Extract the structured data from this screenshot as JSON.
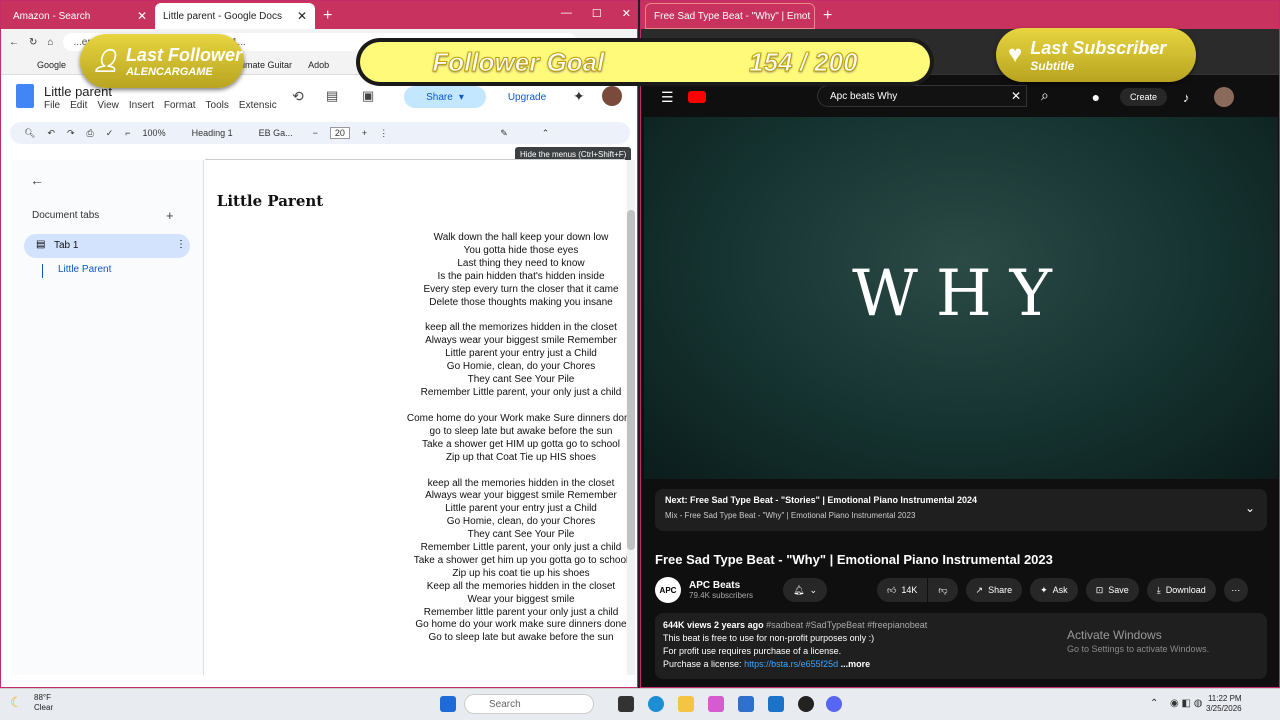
{
  "left_browser": {
    "tabs": [
      {
        "label": "Amazon - Search",
        "active": false
      },
      {
        "label": "Little parent - Google Docs",
        "active": true
      }
    ],
    "url": "...ent/d/1-w2U17PV8uto2KgDFXhjX1...",
    "bookmarks": [
      "Google",
      "Ultimate Guitar",
      "Adob"
    ]
  },
  "docs": {
    "title": "Little parent",
    "menus": [
      "File",
      "Edit",
      "View",
      "Insert",
      "Format",
      "Tools",
      "Extensic"
    ],
    "share_label": "Share",
    "upgrade_label": "Upgrade",
    "toolbar": {
      "zoom": "100%",
      "style": "Heading 1",
      "font": "EB Ga...",
      "font_size": "20"
    },
    "tooltip": "Hide the menus (Ctrl+Shift+F)",
    "sidebar": {
      "heading": "Document tabs",
      "tab_name": "Tab 1",
      "outline_item": "Little Parent"
    },
    "doc_title": "Little Parent",
    "stanzas": [
      [
        "Walk down the hall keep your down low",
        "You gotta hide those eyes",
        "Last thing they need to know",
        "Is the pain hidden that's hidden inside",
        "Every step every turn the closer that it came",
        "Delete those thoughts making you insane"
      ],
      [
        "keep all the memorizes hidden in the closet",
        "Always wear your biggest smile Remember",
        "Little parent your entry just a Child",
        "Go Homie, clean, do your Chores",
        "They cant See Your Pile",
        "Remember Little parent, your only just a child"
      ],
      [
        "Come home do your Work make Sure dinners done",
        "go to sleep late but awake before the sun",
        "Take a shower get HIM up gotta go to school",
        "Zip up that Coat Tie up HIS shoes"
      ],
      [
        "keep all the memories hidden in the closet",
        "Always wear your biggest smile Remember",
        "Little parent your entry just a Child",
        "Go Homie, clean, do your Chores",
        "They cant See Your Pile",
        "Remember Little parent, your only just a child",
        "Take a shower get him up you gotta go to school",
        "Zip up his coat tie up his shoes",
        "Keep all the memories hidden in the closet",
        "Wear your biggest smile",
        "Remember little parent your only just a child",
        "Go home do your work make sure dinners done",
        "Go to sleep late but awake before the sun"
      ]
    ]
  },
  "right_browser": {
    "tab_label": "Free Sad Type Beat - \"Why\" | Emot",
    "search_value": "Apc beats Why",
    "create_label": "Create",
    "video_text": "WHY",
    "next": {
      "label": "Next: Free Sad Type Beat - \"Stories\" | Emotional Piano Instrumental 2024",
      "mix": "Mix - Free Sad Type Beat - \"Why\" | Emotional Piano Instrumental 2023"
    },
    "video_title": "Free Sad Type Beat - \"Why\" | Emotional Piano Instrumental 2023",
    "channel": {
      "avatar": "APC",
      "name": "APC Beats",
      "subs": "79.4K subscribers"
    },
    "actions": {
      "likes": "14K",
      "share": "Share",
      "ask": "Ask",
      "save": "Save",
      "download": "Download"
    },
    "description": {
      "meta": "644K views  2 years ago",
      "tags": "#sadbeat #SadTypeBeat #freepianobeat",
      "line1": "This beat is free to use for non-profit purposes only :)",
      "line2": "For profit use requires purchase of a license.",
      "line3": "Purchase a license:",
      "link": "https://bsta.rs/e655f25d",
      "more": "...more"
    },
    "activate_title": "Activate Windows",
    "activate_sub": "Go to Settings to activate Windows."
  },
  "overlays": {
    "follower_title": "Last Follower",
    "follower_name": "ALENCARGAME",
    "goal_label": "Follower Goal",
    "goal_value": "154 / 200",
    "subscriber_title": "Last Subscriber",
    "subscriber_name": "Subtitle"
  },
  "taskbar": {
    "weather_temp": "88°F",
    "weather_desc": "Clear",
    "search_placeholder": "Search",
    "time": "11:22 PM",
    "date": "3/25/2026"
  }
}
